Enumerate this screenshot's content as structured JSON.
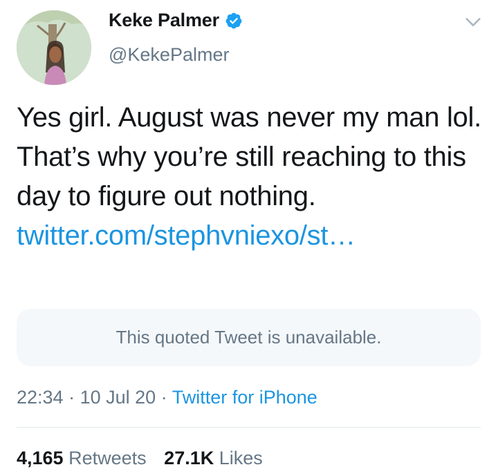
{
  "author": {
    "display_name": "Keke Palmer",
    "handle": "@KekePalmer",
    "verified_icon": "verified-badge-icon",
    "verified_color": "#1da1f2"
  },
  "tweet": {
    "text": "Yes girl. August was never my man lol. That’s why you’re still reaching to this day to figure out nothing.",
    "link": "twitter.com/stephvniexo/st…",
    "quoted_unavailable": "This quoted Tweet is unavailable."
  },
  "meta": {
    "time": "22:34",
    "separator": "·",
    "date": "10 Jul 20",
    "source": "Twitter for iPhone"
  },
  "stats": {
    "retweets_count": "4,165",
    "retweets_label": "Retweets",
    "likes_count": "27.1K",
    "likes_label": "Likes"
  },
  "colors": {
    "text": "#14171a",
    "secondary": "#657786",
    "link": "#1b95e0",
    "quoted_bg": "#f5f8fa"
  }
}
